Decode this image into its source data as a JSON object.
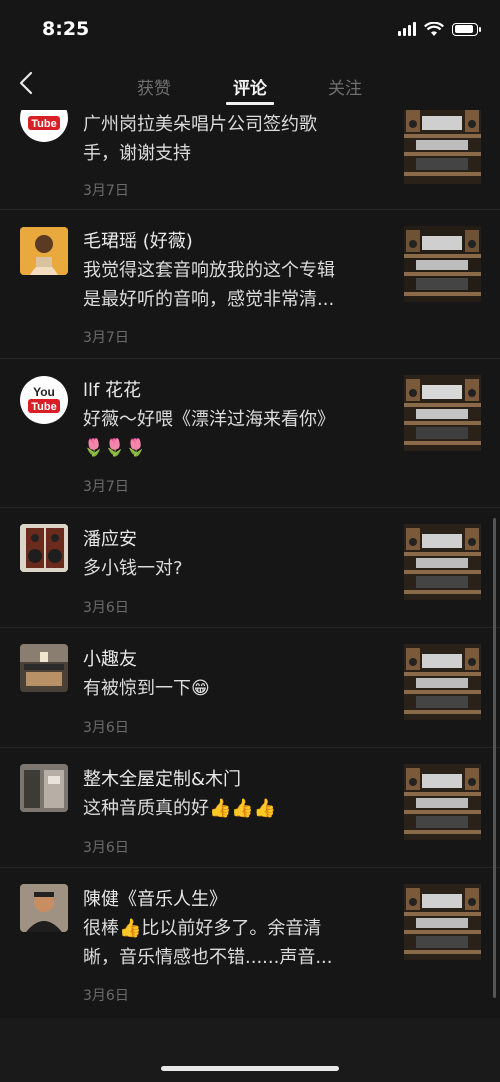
{
  "status": {
    "time": "8:25"
  },
  "nav": {
    "tabs": [
      "获赞",
      "评论",
      "关注"
    ],
    "active_tab": 1
  },
  "comments": [
    {
      "name": "",
      "lines": [
        "广州岗拉美朵唱片公司签约歌",
        "手，谢谢支持"
      ],
      "date": "3月7日",
      "avatar": "youtube-logo"
    },
    {
      "name": "毛珺瑶 (好薇)",
      "lines": [
        "我觉得这套音响放我的这个专辑",
        "是最好听的音响，感觉非常清..."
      ],
      "date": "3月7日",
      "avatar": "person-photo"
    },
    {
      "name": "llf 花花",
      "lines": [
        "好薇～好喂《漂洋过海来看你》",
        ""
      ],
      "date": "3月7日",
      "avatar": "youtube-logo",
      "emoji_line": "🌷🌷🌷"
    },
    {
      "name": "潘应安",
      "lines": [
        "多小钱一对?"
      ],
      "date": "3月6日",
      "avatar": "speaker-photo"
    },
    {
      "name": "小趣友",
      "lines": [
        "有被惊到一下😁"
      ],
      "date": "3月6日",
      "avatar": "room-photo"
    },
    {
      "name": "整木全屋定制&木门",
      "lines": [
        "这种音质真的好👍👍👍"
      ],
      "date": "3月6日",
      "avatar": "interior-photo"
    },
    {
      "name": "陳健《音乐人生》",
      "lines": [
        "很棒👍比以前好多了。余音清",
        "晰，音乐情感也不错......声音..."
      ],
      "date": "3月6日",
      "avatar": "man-photo"
    }
  ]
}
